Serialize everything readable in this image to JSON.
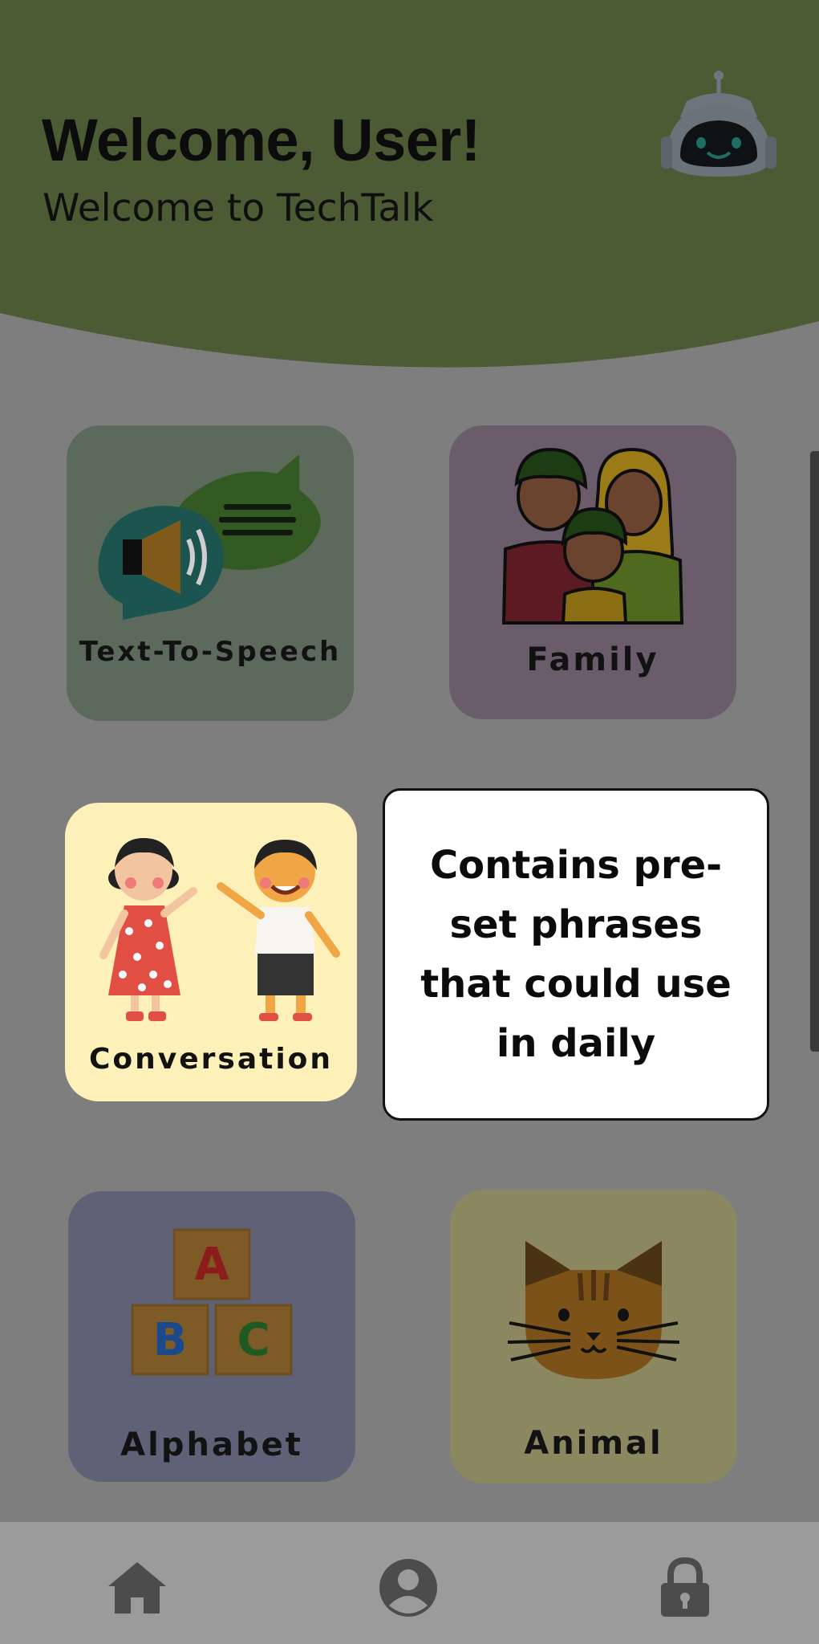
{
  "header": {
    "title": "Welcome, User!",
    "subtitle": "Welcome to TechTalk",
    "mascot_icon": "robot-icon"
  },
  "cards": [
    {
      "id": "tts",
      "label": "Text-To-Speech",
      "icon": "speech-bubbles-speaker-icon"
    },
    {
      "id": "family",
      "label": "Family",
      "icon": "family-icon"
    },
    {
      "id": "conversation",
      "label": "Conversation",
      "icon": "children-waving-icon"
    },
    {
      "id": "alphabet",
      "label": "Alphabet",
      "icon": "abc-blocks-icon"
    },
    {
      "id": "animal",
      "label": "Animal",
      "icon": "cat-icon"
    }
  ],
  "tooltip": {
    "text": "Contains pre-set phrases that could use in daily"
  },
  "bottom_nav": [
    {
      "id": "home",
      "icon": "home-icon"
    },
    {
      "id": "profile",
      "icon": "user-icon"
    },
    {
      "id": "lock",
      "icon": "lock-icon"
    }
  ],
  "colors": {
    "header": "#4b5c35",
    "overlay_background": "#7e7e7e",
    "tooltip_background": "#ffffff",
    "nav_background": "#9b9b9b"
  }
}
